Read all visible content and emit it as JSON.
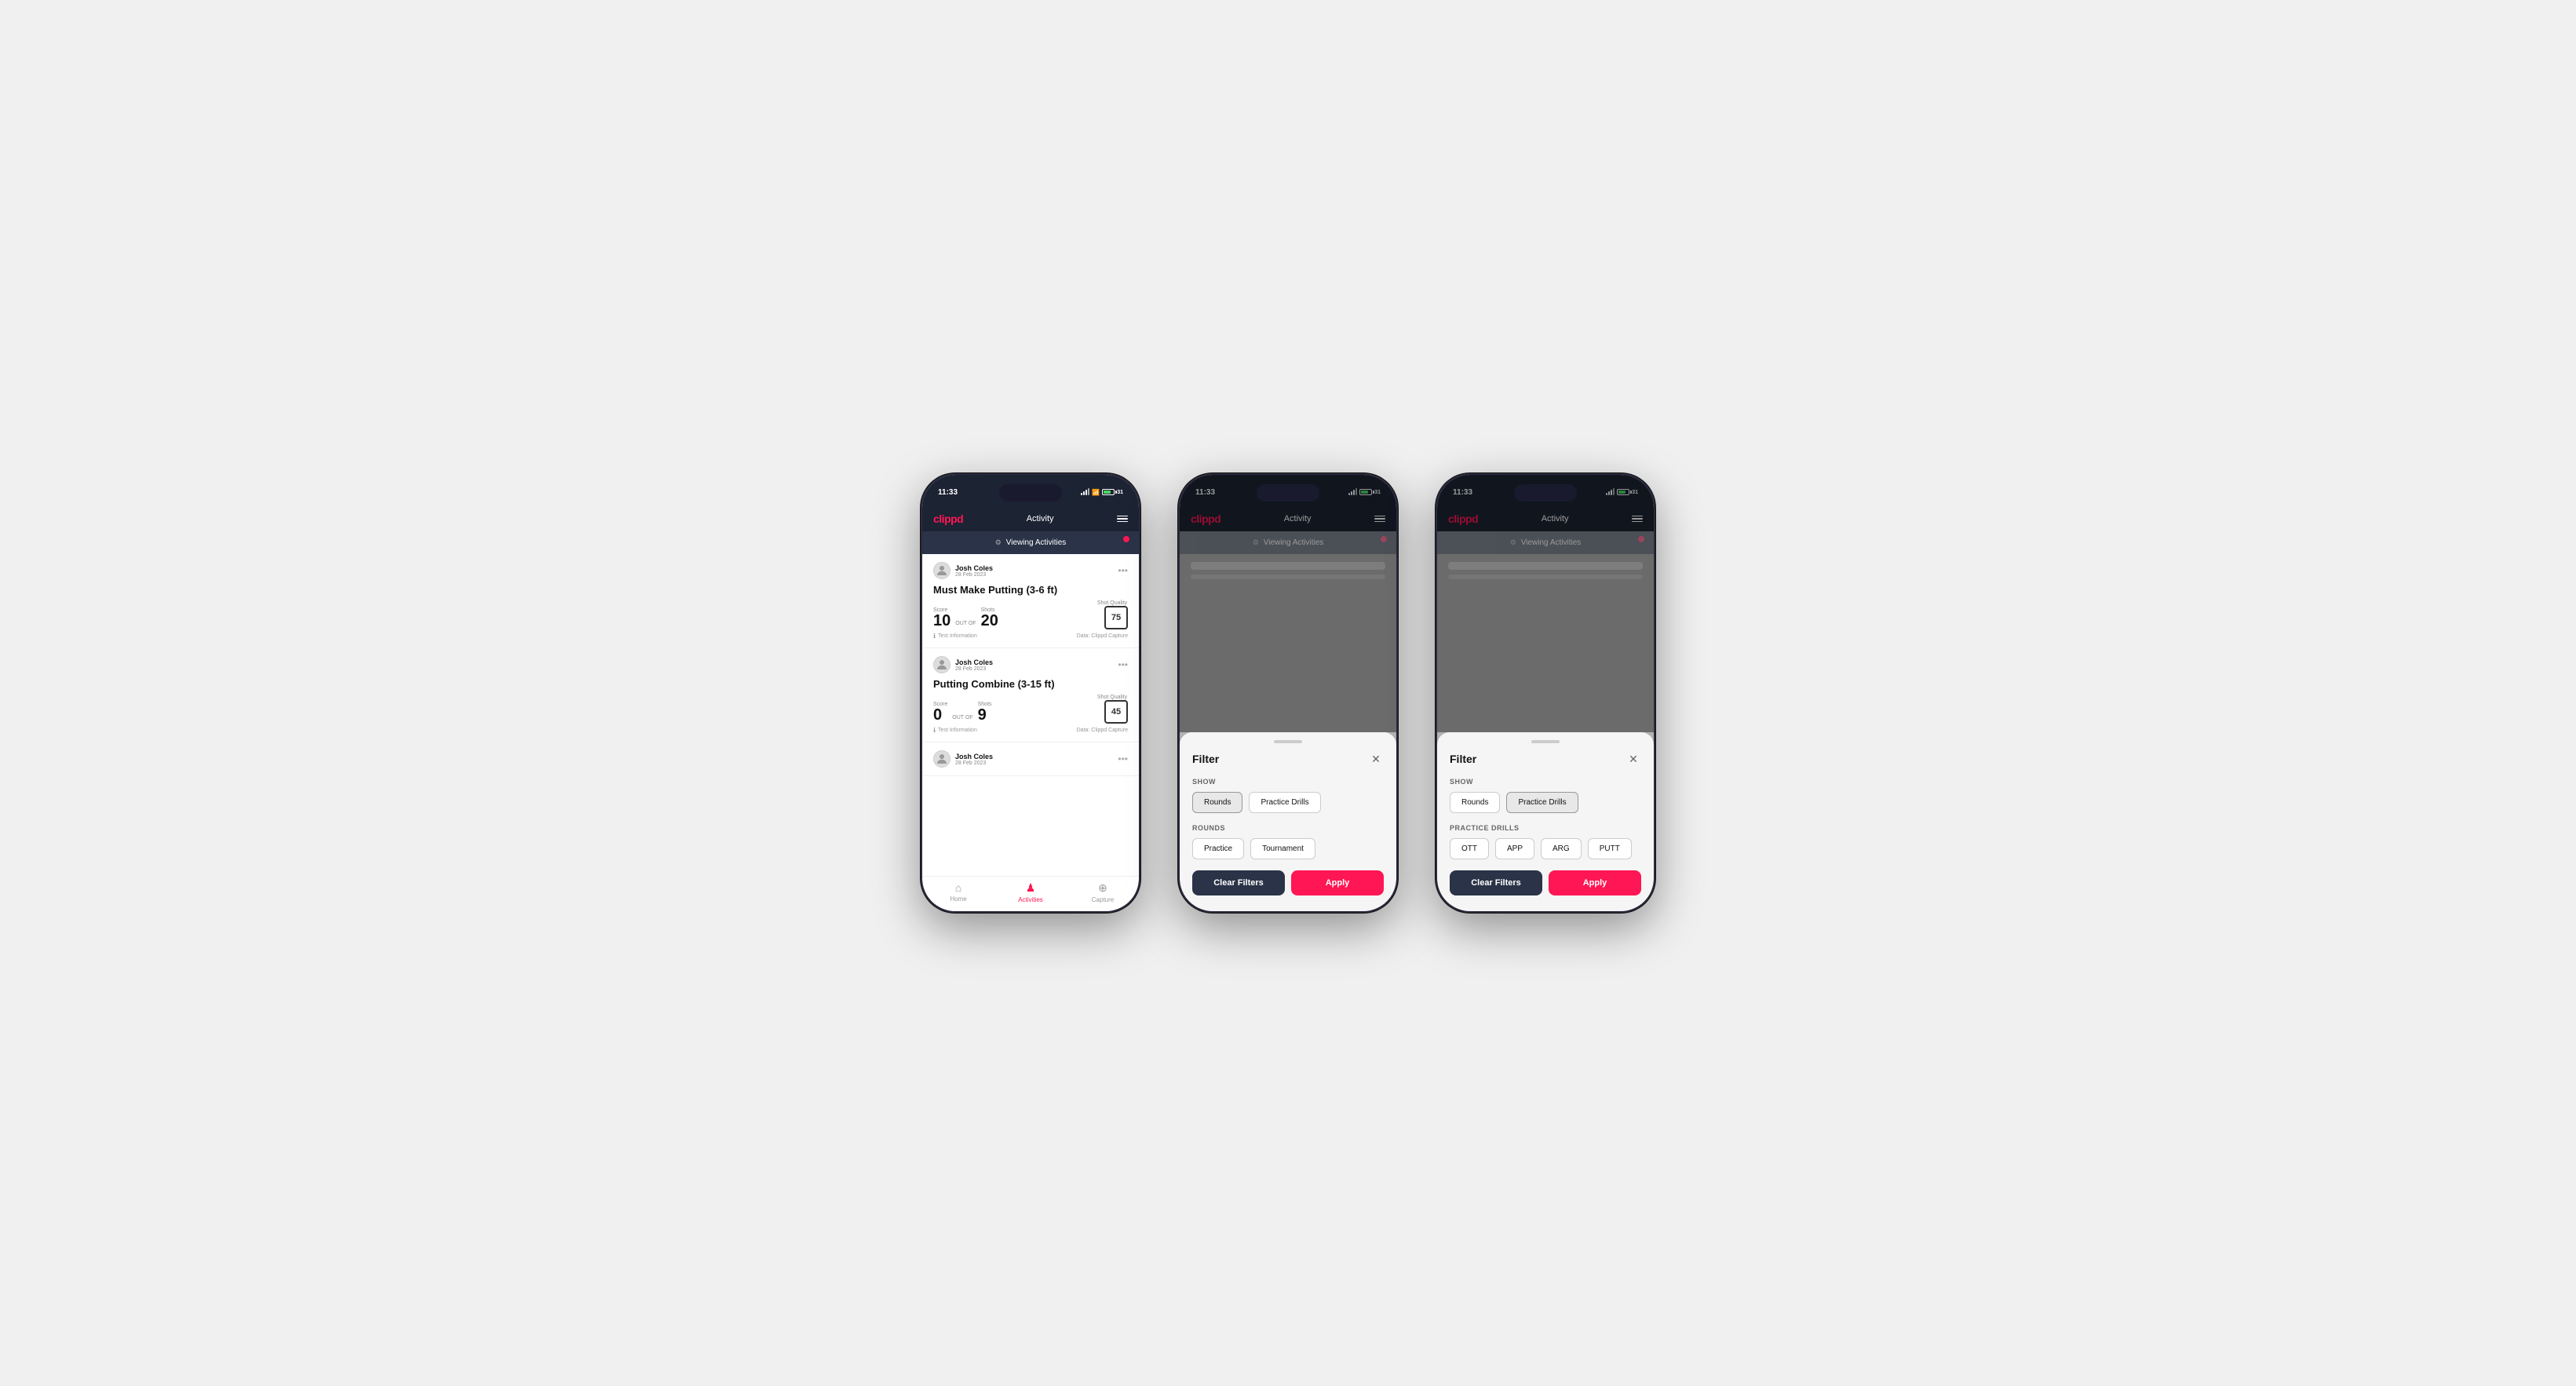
{
  "app": {
    "logo": "clippd",
    "header_title": "Activity",
    "status_time": "11:33",
    "battery_level": "31"
  },
  "phone1": {
    "viewing_bar_text": "Viewing Activities",
    "activities": [
      {
        "user_name": "Josh Coles",
        "user_date": "28 Feb 2023",
        "title": "Must Make Putting (3-6 ft)",
        "score_label": "Score",
        "score_value": "10",
        "shots_label": "Shots",
        "shots_value": "20",
        "shot_quality_label": "Shot Quality",
        "shot_quality_value": "75",
        "test_info": "Test Information",
        "data_source": "Data: Clippd Capture"
      },
      {
        "user_name": "Josh Coles",
        "user_date": "28 Feb 2023",
        "title": "Putting Combine (3-15 ft)",
        "score_label": "Score",
        "score_value": "0",
        "shots_label": "Shots",
        "shots_value": "9",
        "shot_quality_label": "Shot Quality",
        "shot_quality_value": "45",
        "test_info": "Test Information",
        "data_source": "Data: Clippd Capture"
      },
      {
        "user_name": "Josh Coles",
        "user_date": "28 Feb 2023",
        "title": "",
        "score_label": "",
        "score_value": "",
        "shots_label": "",
        "shots_value": "",
        "shot_quality_label": "",
        "shot_quality_value": "",
        "test_info": "",
        "data_source": ""
      }
    ],
    "nav": [
      {
        "label": "Home",
        "icon": "🏠",
        "active": false
      },
      {
        "label": "Activities",
        "icon": "👤",
        "active": true
      },
      {
        "label": "Capture",
        "icon": "⊕",
        "active": false
      }
    ]
  },
  "phone2": {
    "filter_title": "Filter",
    "show_label": "Show",
    "show_buttons": [
      {
        "label": "Rounds",
        "selected": true
      },
      {
        "label": "Practice Drills",
        "selected": false
      }
    ],
    "rounds_label": "Rounds",
    "rounds_buttons": [
      {
        "label": "Practice",
        "selected": false
      },
      {
        "label": "Tournament",
        "selected": false
      }
    ],
    "clear_filters": "Clear Filters",
    "apply": "Apply"
  },
  "phone3": {
    "filter_title": "Filter",
    "show_label": "Show",
    "show_buttons": [
      {
        "label": "Rounds",
        "selected": false
      },
      {
        "label": "Practice Drills",
        "selected": true
      }
    ],
    "practice_drills_label": "Practice Drills",
    "drill_buttons": [
      {
        "label": "OTT",
        "selected": false
      },
      {
        "label": "APP",
        "selected": false
      },
      {
        "label": "ARG",
        "selected": false
      },
      {
        "label": "PUTT",
        "selected": false
      }
    ],
    "clear_filters": "Clear Filters",
    "apply": "Apply"
  }
}
